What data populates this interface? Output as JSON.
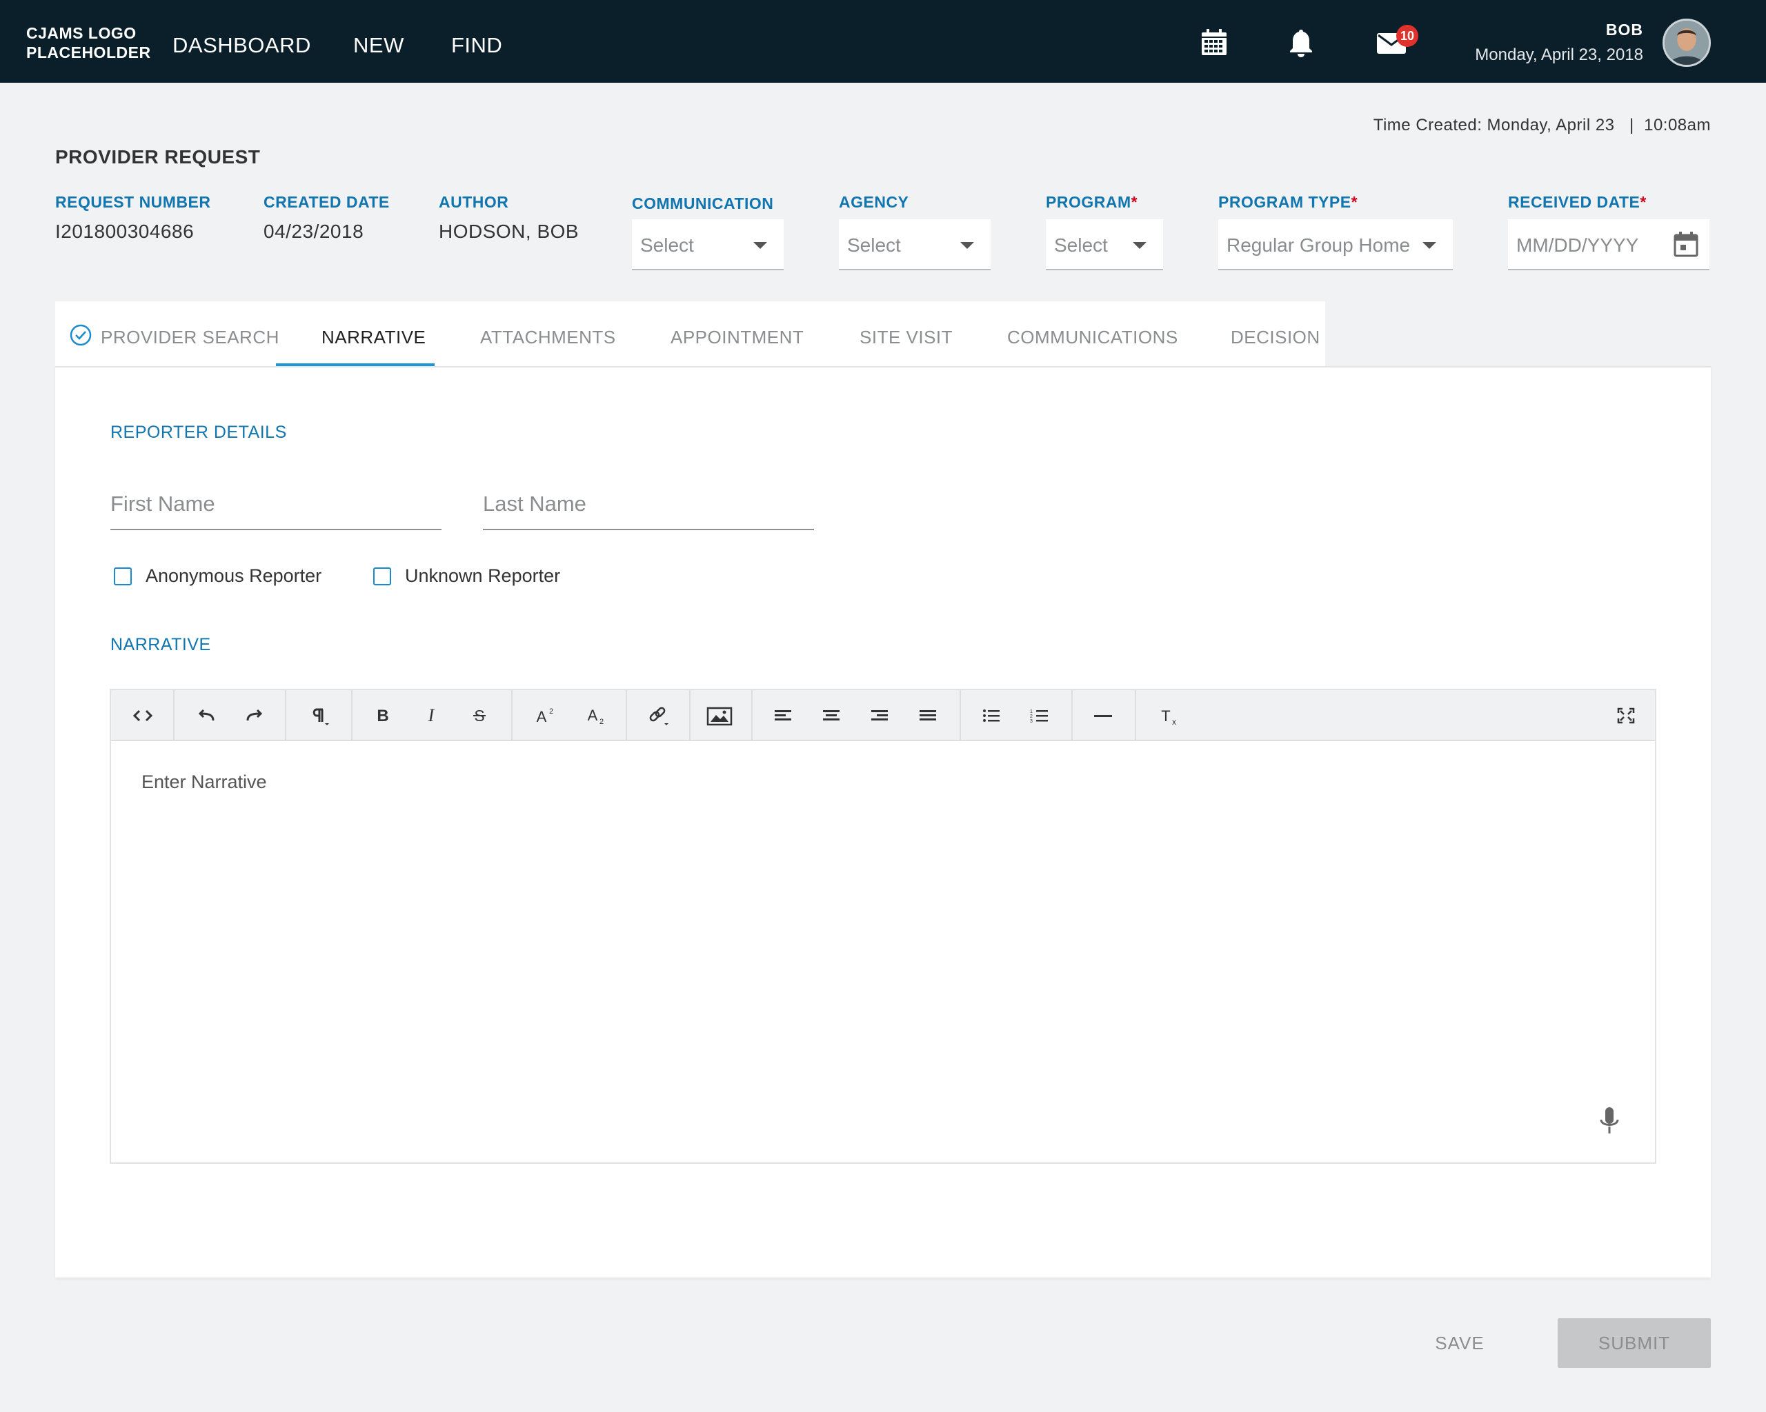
{
  "app": {
    "logo_line1": "CJAMS LOGO",
    "logo_line2": "PLACEHOLDER",
    "nav": [
      "DASHBOARD",
      "NEW",
      "FIND"
    ],
    "mail_badge": "10",
    "user_name": "BOB",
    "user_date": "Monday, April 23, 2018",
    "icons": [
      "calendar-icon",
      "bell-icon",
      "mail-icon"
    ]
  },
  "header": {
    "time_created": "Time Created: Monday, April 23   |  10:08am",
    "title": "PROVIDER REQUEST",
    "request_number_label": "REQUEST NUMBER",
    "request_number": "I201800304686",
    "created_date_label": "CREATED DATE",
    "created_date": "04/23/2018",
    "author_label": "AUTHOR",
    "author": "HODSON, BOB",
    "communication_label": "COMMUNICATION",
    "communication_value": "Select",
    "agency_label": "AGENCY",
    "agency_value": "Select",
    "program_label": "PROGRAM",
    "program_value": "Select",
    "program_type_label": "PROGRAM TYPE",
    "program_type_value": "Regular Group Home",
    "received_date_label": "RECEIVED DATE",
    "received_date_placeholder": "MM/DD/YYYY",
    "required_mark": "*"
  },
  "tabs": [
    "PROVIDER SEARCH",
    "NARRATIVE",
    "ATTACHMENTS",
    "APPOINTMENT",
    "SITE VISIT",
    "COMMUNICATIONS",
    "DECISION"
  ],
  "active_tab": "NARRATIVE",
  "reporter": {
    "section_label": "REPORTER DETAILS",
    "first_name_placeholder": "First Name",
    "last_name_placeholder": "Last Name",
    "anonymous_label": "Anonymous Reporter",
    "unknown_label": "Unknown Reporter"
  },
  "narrative": {
    "section_label": "NARRATIVE",
    "placeholder": "Enter Narrative"
  },
  "footer": {
    "save_label": "SAVE",
    "submit_label": "SUBMIT"
  },
  "colors": {
    "nav_bg": "#0a1f29",
    "accent_blue": "#1176b0",
    "tab_indicator": "#2196d3",
    "required": "#d0021b",
    "badge": "#e0322d"
  }
}
